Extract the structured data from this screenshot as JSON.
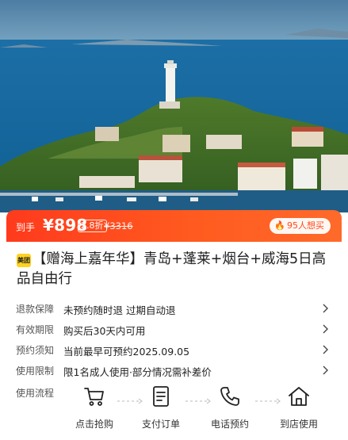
{
  "price_bar": {
    "prefix": "到手",
    "price": "¥898",
    "discount": "2.8折",
    "original_price": "¥3316",
    "want_count": "95人想买"
  },
  "product": {
    "brand_badge": "美团",
    "title": "【赠海上嘉年华】青岛+蓬莱+烟台+威海5日高品自由行"
  },
  "info_rows": [
    {
      "label": "退款保障",
      "value": "未预约随时退 过期自动退"
    },
    {
      "label": "有效期限",
      "value": "购买后30天内可用"
    },
    {
      "label": "预约须知",
      "value": "当前最早可预约2025.09.05"
    },
    {
      "label": "使用限制",
      "value": "限1名成人使用·部分情况需补差价"
    }
  ],
  "flow": {
    "label": "使用流程",
    "steps": [
      {
        "label": "点击抢购",
        "icon": "cart-icon"
      },
      {
        "label": "支付订单",
        "icon": "order-icon"
      },
      {
        "label": "电话预约",
        "icon": "phone-icon"
      },
      {
        "label": "到店使用",
        "icon": "store-icon"
      }
    ]
  },
  "colors": {
    "accent": "#ff4a1a",
    "brand_yellow": "#ffd21f"
  }
}
